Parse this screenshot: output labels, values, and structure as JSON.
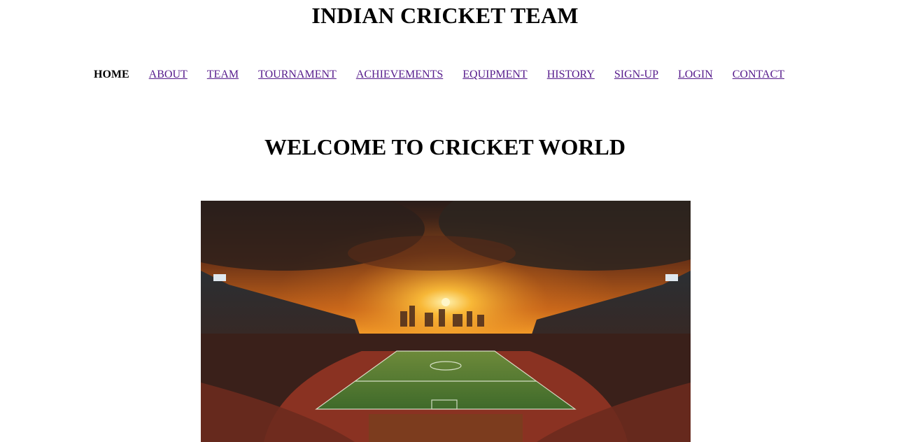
{
  "header": {
    "title": "INDIAN CRICKET TEAM"
  },
  "nav": {
    "items": [
      {
        "label": "HOME",
        "active": true
      },
      {
        "label": "ABOUT"
      },
      {
        "label": "TEAM"
      },
      {
        "label": "TOURNAMENT"
      },
      {
        "label": "ACHIEVEMENTS"
      },
      {
        "label": "EQUIPMENT"
      },
      {
        "label": "HISTORY"
      },
      {
        "label": "SIGN-UP"
      },
      {
        "label": "LOGIN"
      },
      {
        "label": "CONTACT"
      }
    ],
    "link_color": "#551a8b"
  },
  "main": {
    "heading": "WELCOME TO CRICKET WORLD",
    "hero_image": "stadium-at-sunset"
  }
}
